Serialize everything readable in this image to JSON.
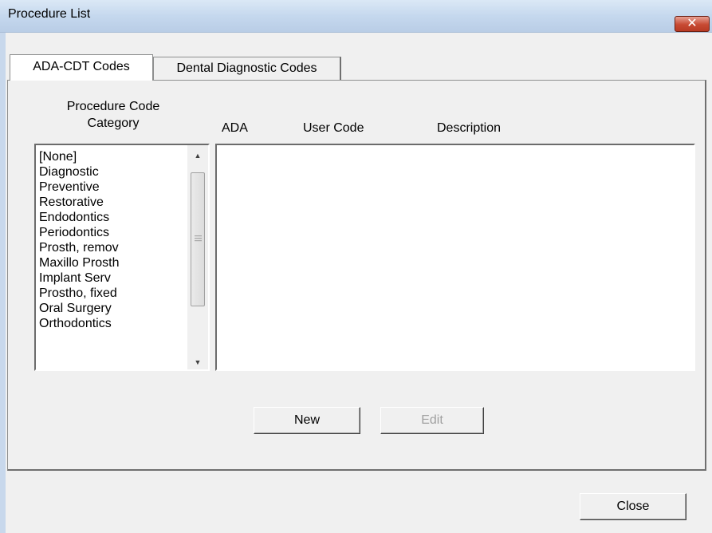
{
  "window": {
    "title": "Procedure List",
    "close_icon": "✕"
  },
  "tabs": [
    {
      "label": "ADA-CDT Codes",
      "active": true
    },
    {
      "label": "Dental Diagnostic Codes",
      "active": false
    }
  ],
  "category_panel": {
    "heading_line1": "Procedure Code",
    "heading_line2": "Category",
    "items": [
      "[None]",
      "Diagnostic",
      "Preventive",
      "Restorative",
      "Endodontics",
      "Periodontics",
      "Prosth, remov",
      "Maxillo Prosth",
      "Implant Serv",
      "Prostho, fixed",
      "Oral Surgery",
      "Orthodontics"
    ]
  },
  "code_table": {
    "columns": [
      "ADA",
      "User Code",
      "Description"
    ],
    "rows": []
  },
  "buttons": {
    "new_label": "New",
    "edit_label": "Edit",
    "close_label": "Close"
  },
  "scrollbar_icons": {
    "up": "scroll-up-arrow-icon",
    "down": "scroll-down-arrow-icon"
  }
}
